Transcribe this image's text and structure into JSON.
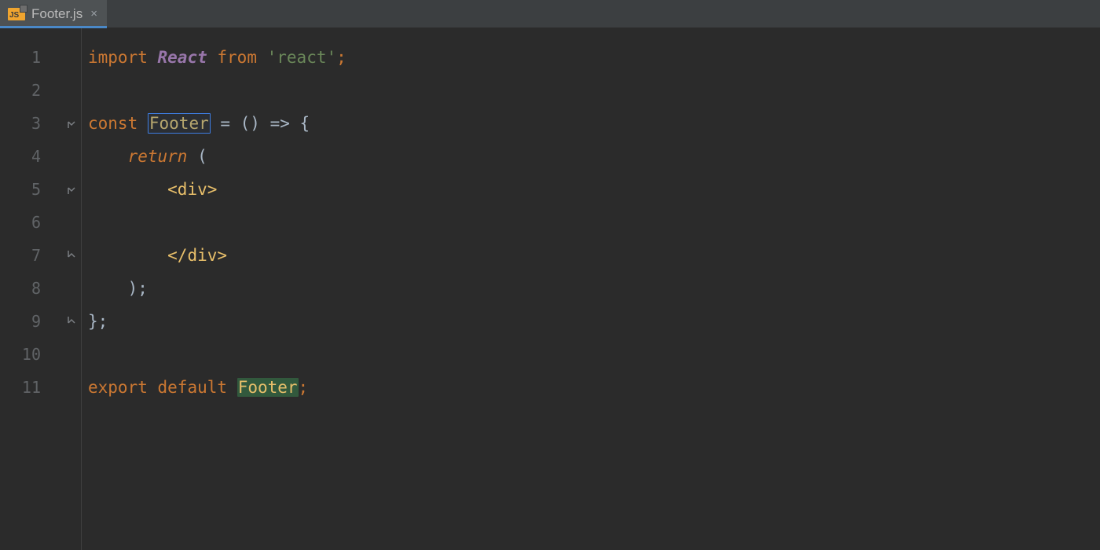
{
  "tab": {
    "badge": "JS",
    "filename": "Footer.js"
  },
  "gutter": [
    "1",
    "2",
    "3",
    "4",
    "5",
    "6",
    "7",
    "8",
    "9",
    "10",
    "11"
  ],
  "code": {
    "l1_import": "import",
    "l1_react": "React",
    "l1_from": "from",
    "l1_str": "'react'",
    "l1_semi": ";",
    "l3_const": "const",
    "l3_name": "Footer",
    "l3_rest": " = () => {",
    "l4_return": "return",
    "l4_paren": " (",
    "l5_tag": "<div>",
    "l7_tag": "</div>",
    "l8": "    );",
    "l9": "};",
    "l11_export": "export",
    "l11_default": "default",
    "l11_name": "Footer",
    "l11_semi": ";"
  }
}
